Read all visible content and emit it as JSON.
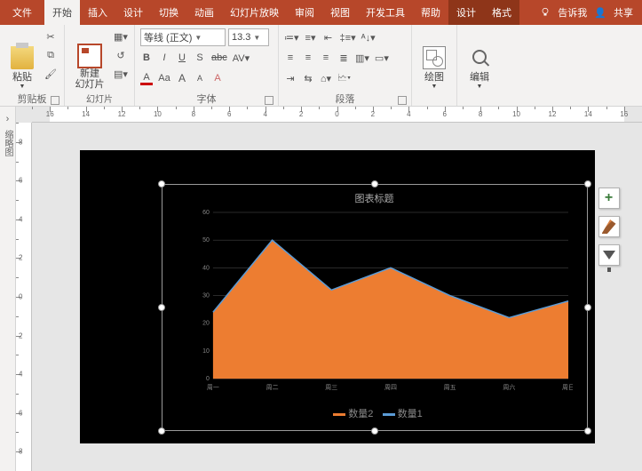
{
  "titlebar": {
    "tabs": [
      "文件",
      "开始",
      "插入",
      "设计",
      "切换",
      "动画",
      "幻灯片放映",
      "审阅",
      "视图",
      "开发工具",
      "帮助",
      "设计",
      "格式"
    ],
    "active_index": 1,
    "dark_indices": [
      11,
      12
    ],
    "tell_me": "告诉我",
    "share": "共享"
  },
  "ribbon": {
    "clipboard": {
      "paste": "粘贴",
      "label": "剪贴板"
    },
    "slides": {
      "new_slide": "新建\n幻灯片",
      "label": "幻灯片"
    },
    "font": {
      "name": "等线 (正文)",
      "size": "13.3",
      "buttons": [
        "B",
        "I",
        "U",
        "S",
        "abc",
        "AV"
      ],
      "row3": [
        "A",
        "Aa",
        "A",
        "A",
        "A"
      ],
      "label": "字体"
    },
    "paragraph": {
      "label": "段落"
    },
    "drawing": {
      "btn": "绘图",
      "label": ""
    },
    "editing": {
      "btn": "编辑",
      "label": ""
    }
  },
  "ruler": {
    "h": [
      16,
      14,
      12,
      10,
      8,
      6,
      4,
      2,
      0,
      2,
      4,
      6,
      8,
      10,
      12,
      14,
      16
    ],
    "v": [
      8,
      6,
      4,
      2,
      0,
      2,
      4,
      6,
      8
    ]
  },
  "chart_data": {
    "type": "area+line",
    "title": "图表标题",
    "categories": [
      "周一",
      "周二",
      "周三",
      "周四",
      "周五",
      "周六",
      "周日"
    ],
    "series": [
      {
        "name": "数量2",
        "type": "area",
        "values": [
          24,
          50,
          32,
          40,
          30,
          22,
          28
        ]
      },
      {
        "name": "数量1",
        "type": "line",
        "values": [
          24,
          50,
          32,
          40,
          30,
          22,
          28
        ]
      }
    ],
    "ylim": [
      0,
      60
    ],
    "yticks": [
      0,
      10,
      20,
      30,
      40,
      50,
      60
    ]
  },
  "side_buttons": [
    "plus",
    "brush",
    "filter"
  ]
}
